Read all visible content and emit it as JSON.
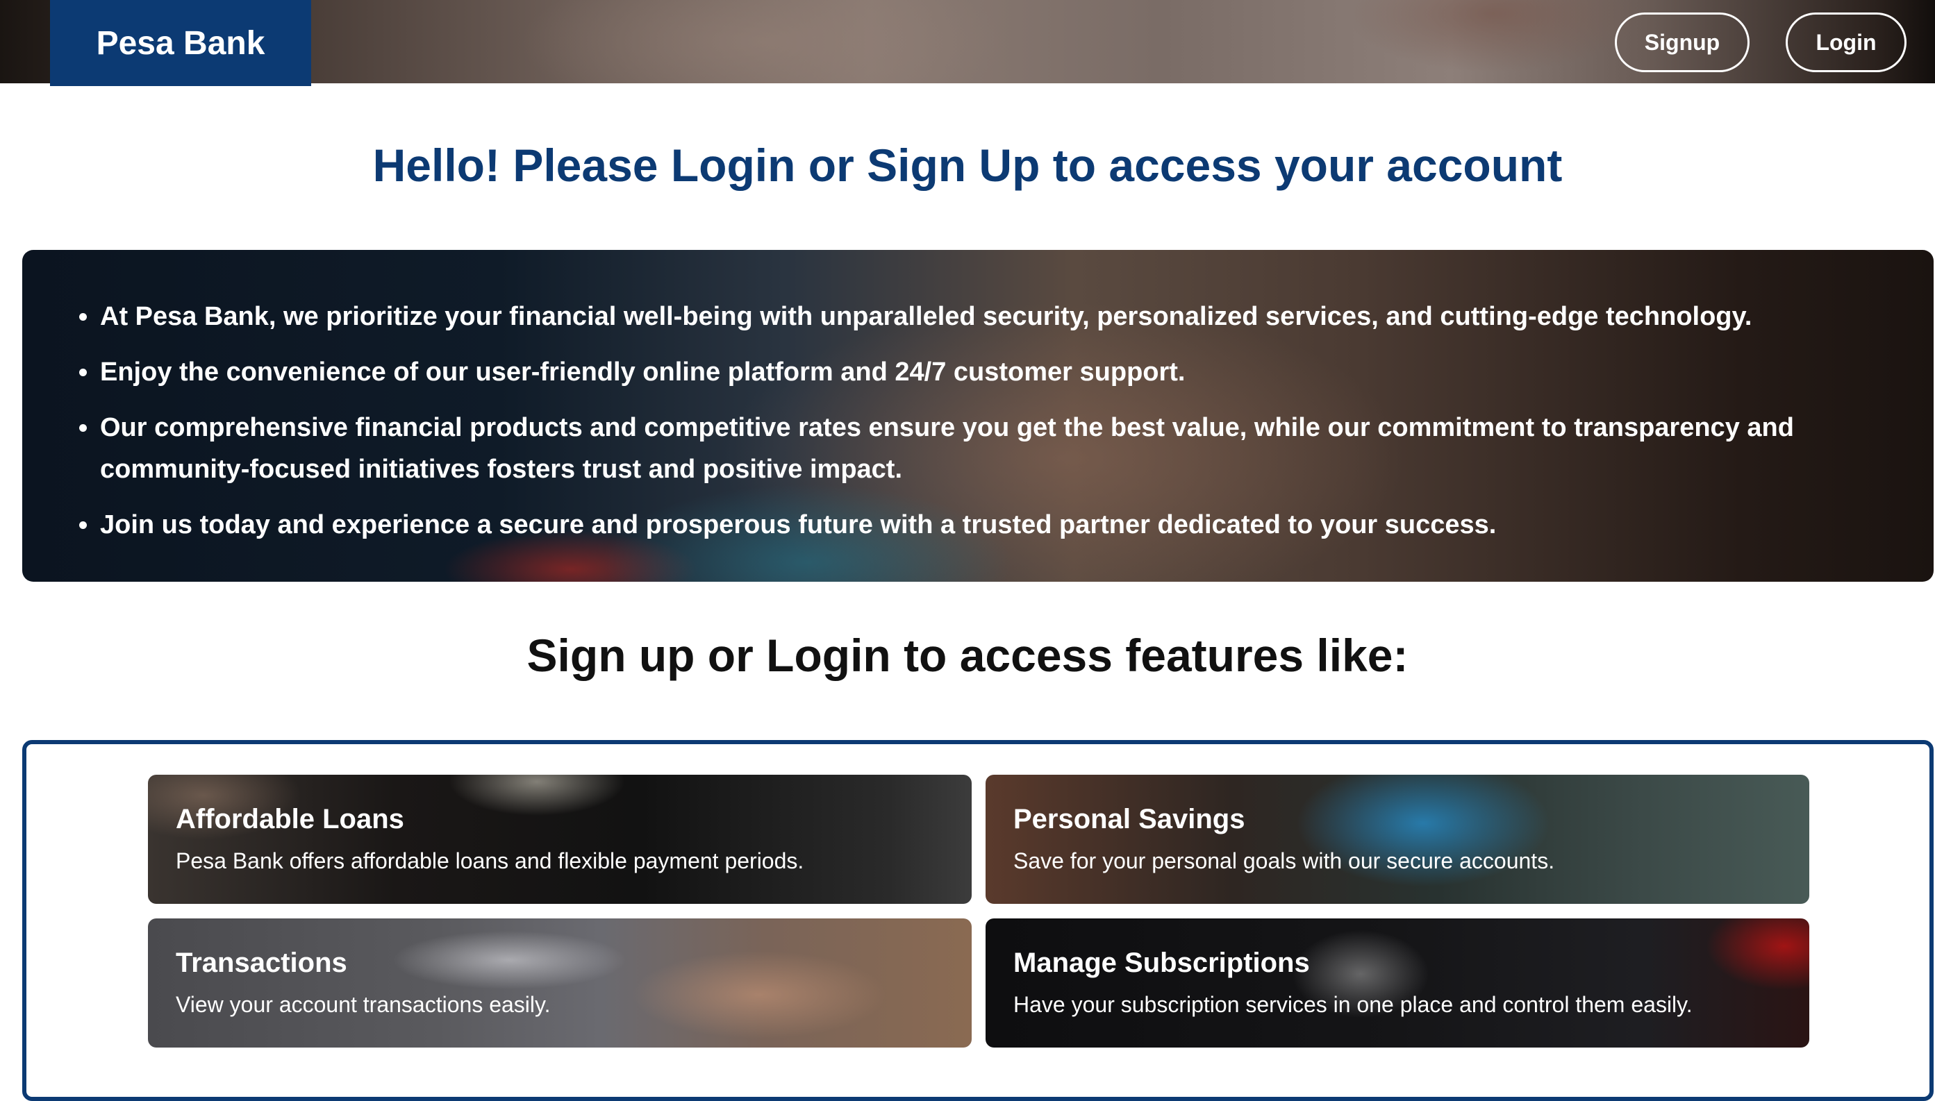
{
  "header": {
    "brand": "Pesa Bank",
    "signup_label": "Signup",
    "login_label": "Login"
  },
  "hero": {
    "title": "Hello! Please Login or Sign Up to access your account",
    "points": [
      "At Pesa Bank, we prioritize your financial well-being with unparalleled security, personalized services, and cutting-edge technology.",
      "Enjoy the convenience of our user-friendly online platform and 24/7 customer support.",
      "Our comprehensive financial products and competitive rates ensure you get the best value, while our commitment to transparency and community-focused initiatives fosters trust and positive impact.",
      "Join us today and experience a secure and prosperous future with a trusted partner dedicated to your success."
    ]
  },
  "features": {
    "heading": "Sign up or Login to access features like:",
    "cards": [
      {
        "title": "Affordable Loans",
        "description": "Pesa Bank offers affordable loans and flexible payment periods."
      },
      {
        "title": "Personal Savings",
        "description": "Save for your personal goals with our secure accounts."
      },
      {
        "title": "Transactions",
        "description": "View your account transactions easily."
      },
      {
        "title": "Manage Subscriptions",
        "description": "Have your subscription services in one place and control them easily."
      }
    ]
  },
  "colors": {
    "brand_navy": "#0c3a73",
    "heading_dark": "#111111",
    "text_light": "#ffffff"
  }
}
